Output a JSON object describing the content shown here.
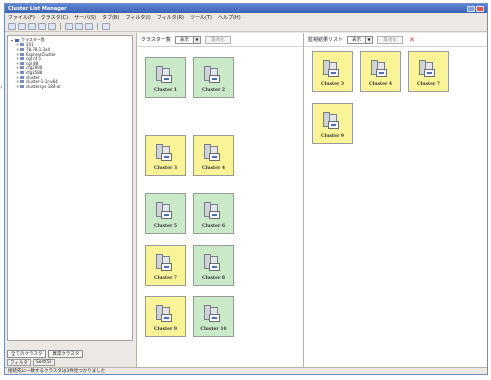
{
  "window": {
    "title": "Cluster List Manager"
  },
  "menu": [
    "ファイル(F)",
    "クラスタ(C)",
    "サーバ(S)",
    "タブ(B)",
    "フィルタ(I)",
    "フィルタ(R)",
    "ツール(T)",
    "ヘルプ(H)"
  ],
  "tree": {
    "root": "クラスター覧",
    "items": [
      "101",
      "78.78.1.3x4",
      "ExpressCluster",
      "cgl nf 5",
      "cgl 88",
      "cfg2000",
      "cfg3588",
      "cluster",
      "cluster-1-1r-u64",
      "clustersyv-184-ol"
    ]
  },
  "bottom_tabs": [
    "全てのクラスタ",
    "異常クラスタ"
  ],
  "filters": [
    "フィルタ",
    "Sort(S)"
  ],
  "cluster_panel": {
    "title": "クラスター覧",
    "dropdown": "表示",
    "button": "最適化",
    "cards": [
      {
        "label": "Cluster 1",
        "status": "green"
      },
      {
        "label": "Cluster 2",
        "status": "green"
      },
      {
        "label": "Cluster 3",
        "status": "yellow"
      },
      {
        "label": "Cluster 4",
        "status": "yellow"
      },
      {
        "label": "Cluster 5",
        "status": "green"
      },
      {
        "label": "Cluster 6",
        "status": "green"
      },
      {
        "label": "Cluster 7",
        "status": "yellow"
      },
      {
        "label": "Cluster 8",
        "status": "green"
      },
      {
        "label": "Cluster 9",
        "status": "yellow"
      },
      {
        "label": "Cluster 10",
        "status": "green"
      }
    ]
  },
  "monitor_panel": {
    "title": "監視結果リスト",
    "dropdown": "表示",
    "button": "最適化",
    "cards": [
      {
        "label": "Cluster 3",
        "status": "yellow"
      },
      {
        "label": "Cluster 4",
        "status": "yellow"
      },
      {
        "label": "Cluster 7",
        "status": "yellow"
      },
      {
        "label": "Cluster 9",
        "status": "yellow"
      }
    ]
  },
  "status": {
    "text": "接続先に一致するクラスタは3件見つかりました"
  },
  "colors": {
    "normal": "#c9e9c8",
    "warning": "#f9f497",
    "titlebar": "#3b62b3",
    "close": "#d03b2e"
  }
}
